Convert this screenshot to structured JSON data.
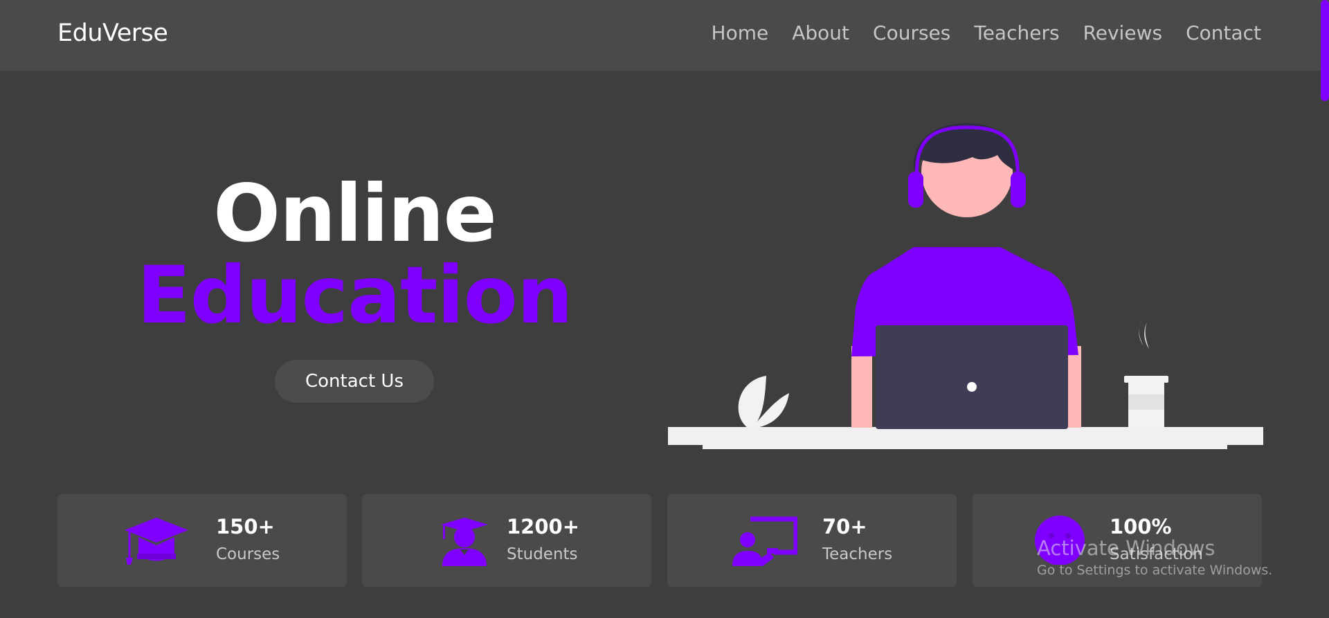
{
  "brand": "EduVerse",
  "nav": [
    "Home",
    "About",
    "Courses",
    "Teachers",
    "Reviews",
    "Contact"
  ],
  "hero": {
    "line1": "Online",
    "line2": "Education",
    "cta": "Contact Us"
  },
  "stats": [
    {
      "value": "150+",
      "label": "Courses",
      "icon": "graduation-cap-icon"
    },
    {
      "value": "1200+",
      "label": "Students",
      "icon": "student-icon"
    },
    {
      "value": "70+",
      "label": "Teachers",
      "icon": "teacher-board-icon"
    },
    {
      "value": "100%",
      "label": "Satisfaction",
      "icon": "smile-icon"
    }
  ],
  "watermark": {
    "title": "Activate Windows",
    "subtitle": "Go to Settings to activate Windows."
  },
  "colors": {
    "accent": "#8000ff",
    "background": "#3e3e3e",
    "navbar": "#4a4a4a",
    "card": "#4a4a4a"
  }
}
